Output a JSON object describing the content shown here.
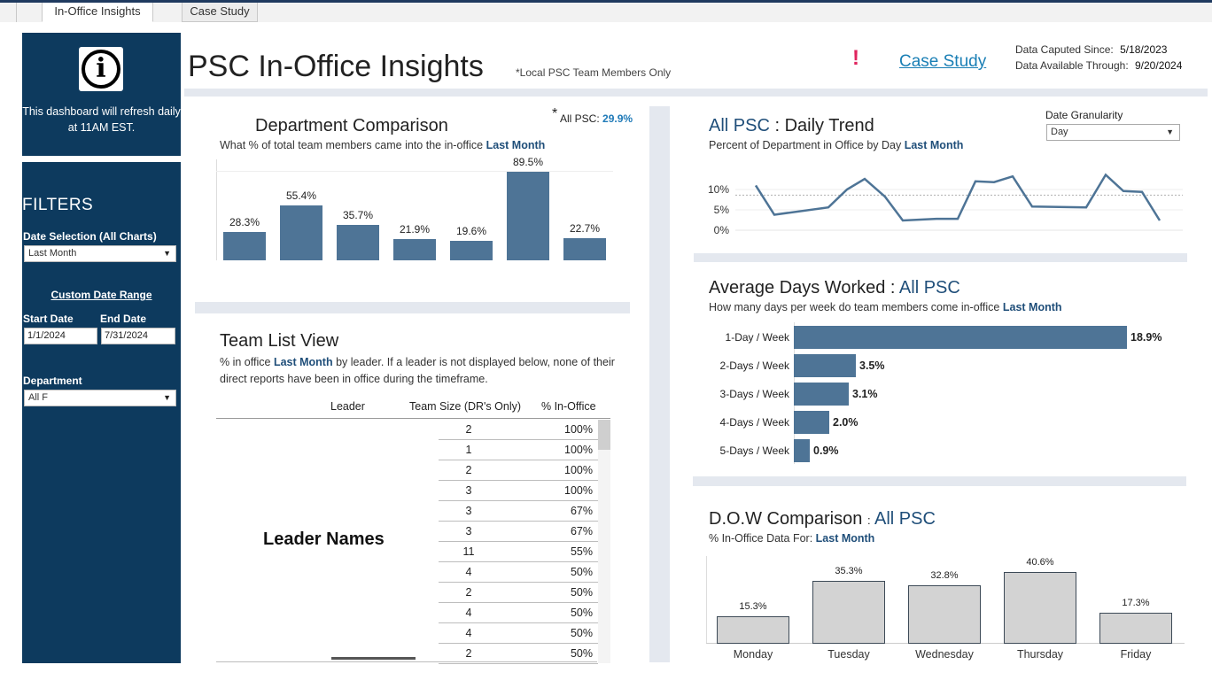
{
  "tabs": [
    {
      "label": "In-Office Insights",
      "active": true
    },
    {
      "label": "Case Study",
      "active": false
    }
  ],
  "sidebar": {
    "info_icon": "info-icon",
    "refresh_note": "This dashboard will refresh daily at 11AM EST.",
    "filters_title": "FILTERS",
    "date_selection_label": "Date Selection (All Charts)",
    "date_selection_value": "Last Month",
    "custom_range_label": "Custom Date Range",
    "start_date_label": "Start Date",
    "end_date_label": "End Date",
    "start_date_value": "1/1/2024",
    "end_date_value": "7/31/2024",
    "department_label": "Department",
    "department_value": "All F"
  },
  "header": {
    "title": "PSC In-Office Insights",
    "note": "*Local PSC Team Members Only",
    "alert": "!",
    "case_study_link": "Case Study",
    "captured_label": "Data Caputed Since:",
    "captured_value": "5/18/2023",
    "available_label": "Data Available Through:",
    "available_value": "9/20/2024"
  },
  "dept": {
    "title": "Department Comparison",
    "subtitle": "What % of total team members came into the in-office",
    "period": "Last Month",
    "allpsc_star": "*",
    "allpsc_label": "All PSC:",
    "allpsc_value": "29.9%",
    "chart_data": {
      "type": "bar",
      "title": "Department Comparison",
      "values": [
        28.3,
        55.4,
        35.7,
        21.9,
        19.6,
        89.5,
        22.7
      ],
      "labels": [
        "28.3%",
        "55.4%",
        "35.7%",
        "21.9%",
        "19.6%",
        "89.5%",
        "22.7%"
      ],
      "ylim": [
        0,
        100
      ]
    }
  },
  "team": {
    "title": "Team List View",
    "subtitle_pre": "% in office",
    "period": "Last Month",
    "subtitle_post": "by leader. If a leader is not displayed below, none of their direct reports have been in office during the timeframe.",
    "col_leader": "Leader",
    "col_size": "Team Size (DR's Only)",
    "col_pct": "% In-Office",
    "leader_names": "Leader Names",
    "rows": [
      {
        "size": "2",
        "pct": "100%"
      },
      {
        "size": "1",
        "pct": "100%"
      },
      {
        "size": "2",
        "pct": "100%"
      },
      {
        "size": "3",
        "pct": "100%"
      },
      {
        "size": "3",
        "pct": "67%"
      },
      {
        "size": "3",
        "pct": "67%"
      },
      {
        "size": "11",
        "pct": "55%"
      },
      {
        "size": "4",
        "pct": "50%"
      },
      {
        "size": "2",
        "pct": "50%"
      },
      {
        "size": "4",
        "pct": "50%"
      },
      {
        "size": "4",
        "pct": "50%"
      },
      {
        "size": "2",
        "pct": "50%"
      }
    ]
  },
  "trend": {
    "title_a": "All PSC",
    "title_b": ": Daily Trend",
    "subtitle": "Percent of Department in Office by Day",
    "period": "Last Month",
    "granularity_label": "Date Granularity",
    "granularity_value": "Day",
    "chart_data": {
      "type": "line",
      "y_ticks": [
        "10%",
        "5%",
        "0%"
      ],
      "ylim": [
        0,
        12
      ],
      "values": [
        11.0,
        3.8,
        5.6,
        10.0,
        12.6,
        8.2,
        2.4,
        2.8,
        2.8,
        12.0,
        11.8,
        13.2,
        5.8,
        5.6,
        13.6,
        9.6,
        9.4,
        2.4
      ],
      "reference_line": 8.6
    }
  },
  "avgdays": {
    "title_a": "Average Days Worked :",
    "title_b": "All PSC",
    "subtitle": "How many days per week do team members come in-office",
    "period": "Last Month",
    "chart_data": {
      "type": "bar",
      "orientation": "horizontal",
      "categories": [
        "1-Day / Week",
        "2-Days / Week",
        "3-Days / Week",
        "4-Days / Week",
        "5-Days / Week"
      ],
      "values": [
        18.9,
        3.5,
        3.1,
        2.0,
        0.9
      ],
      "labels": [
        "18.9%",
        "3.5%",
        "3.1%",
        "2.0%",
        "0.9%"
      ]
    }
  },
  "dow": {
    "title_a": "D.O.W Comparison",
    "title_sep": ":",
    "title_b": "All PSC",
    "subtitle": "% In-Office Data For:",
    "period": "Last Month",
    "chart_data": {
      "type": "bar",
      "categories": [
        "Monday",
        "Tuesday",
        "Wednesday",
        "Thursday",
        "Friday"
      ],
      "values": [
        15.3,
        35.3,
        32.8,
        40.6,
        17.3
      ],
      "labels": [
        "15.3%",
        "35.3%",
        "32.8%",
        "40.6%",
        "17.3%"
      ],
      "ylim": [
        0,
        45
      ]
    }
  },
  "colors": {
    "sidebar": "#0d3a5e",
    "bar": "#4e7496",
    "accent": "#1f4e79",
    "link": "#1a7fb5",
    "alert": "#e0245e"
  }
}
